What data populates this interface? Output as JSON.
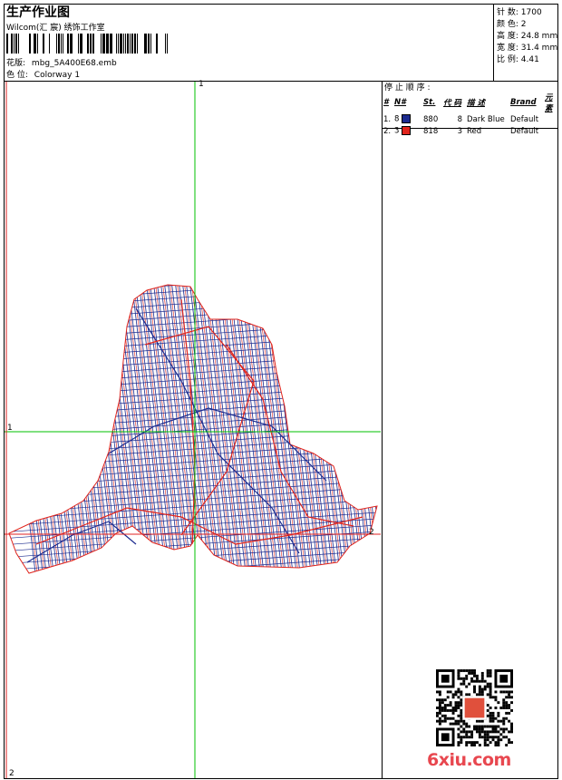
{
  "header": {
    "title": "生产作业图",
    "company": "Wilcom(汇 宸) 绣饰工作室",
    "design_label": "花版:",
    "design_name": "mbg_5A400E68.emb",
    "colorway_label": "色 位:",
    "colorway_name": "Colorway 1"
  },
  "stats": [
    {
      "label": "针 数:",
      "value": "1700"
    },
    {
      "label": "颜 色:",
      "value": "2"
    },
    {
      "label": "高 度:",
      "value": "24.8 mm"
    },
    {
      "label": "宽 度:",
      "value": "31.4 mm"
    },
    {
      "label": "比 例:",
      "value": "4.41"
    }
  ],
  "stop_sequence": {
    "title": "停 止 顺 序 :",
    "headers": [
      "#",
      "N#",
      "St.",
      "代 码",
      "描 述",
      "Brand",
      "元 素"
    ],
    "rows": [
      {
        "index": "1.",
        "n": "8",
        "color": "#1c2b8f",
        "st": "880",
        "code": "8",
        "desc": "Dark Blue",
        "brand": "Default"
      },
      {
        "index": "2.",
        "n": "3",
        "color": "#e0241c",
        "st": "818",
        "code": "3",
        "desc": "Red",
        "brand": "Default"
      }
    ]
  },
  "axes": {
    "v1": "1",
    "h1": "1",
    "h2": "2",
    "v2": "2"
  },
  "colors": {
    "thread_blue": "#1c2b8f",
    "thread_red": "#e0241c",
    "guide_green": "#00c000",
    "guide_red": "#e02020",
    "brand_red": "#e8474f"
  },
  "watermark": {
    "brand": "6xiu.com"
  }
}
